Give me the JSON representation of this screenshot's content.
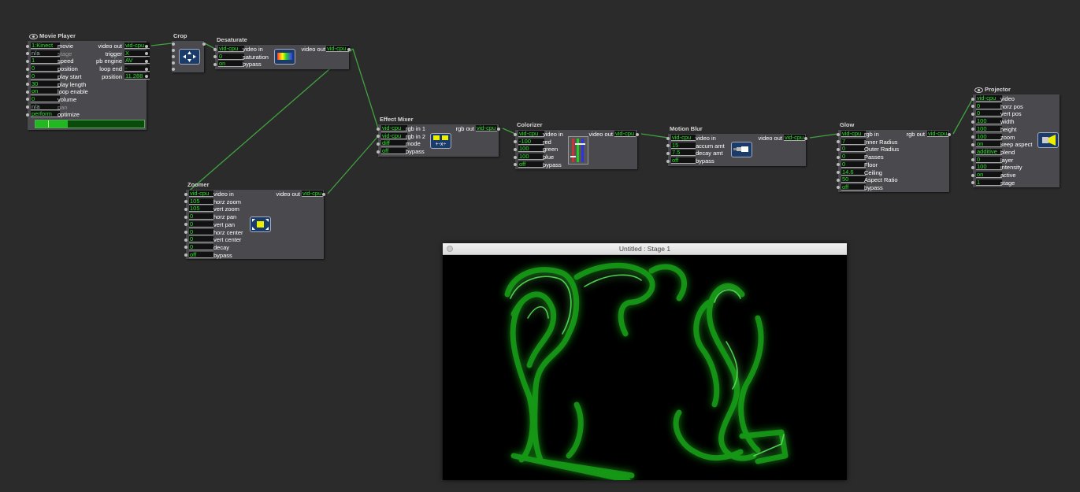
{
  "stage_window": {
    "title": "Untitled : Stage 1"
  },
  "actors": {
    "movie_player": {
      "title": "Movie Player",
      "inputs": [
        {
          "value": "1:Kinect",
          "label": "movie"
        },
        {
          "value": "n/a",
          "label": "stage",
          "dim": true
        },
        {
          "value": "1",
          "label": "speed"
        },
        {
          "value": "0",
          "label": "position"
        },
        {
          "value": "0",
          "label": "play start"
        },
        {
          "value": "30",
          "label": "play length"
        },
        {
          "value": "on",
          "label": "loop enable"
        },
        {
          "value": "0",
          "label": "volume"
        },
        {
          "value": "n/a",
          "label": "pan",
          "dim": true
        },
        {
          "value": "perform",
          "label": "optimize"
        }
      ],
      "outputs": [
        {
          "label": "video out",
          "value": "vid-cpu"
        },
        {
          "label": "trigger",
          "value": "X"
        },
        {
          "label": "pb engine",
          "value": "AV"
        },
        {
          "label": "loop end",
          "value": "-"
        },
        {
          "label": "position",
          "value": "11.288"
        }
      ],
      "progress": 0.3
    },
    "crop": {
      "title": "Crop"
    },
    "desaturate": {
      "title": "Desaturate",
      "inputs": [
        {
          "value": "vid-cpu",
          "label": "video in"
        },
        {
          "value": "0",
          "label": "saturation"
        },
        {
          "value": "on",
          "label": "bypass"
        }
      ],
      "outputs": [
        {
          "label": "video out",
          "value": "vid-cpu"
        }
      ]
    },
    "effect_mixer": {
      "title": "Effect Mixer",
      "inputs": [
        {
          "value": "vid-cpu",
          "label": "rgb in 1"
        },
        {
          "value": "vid-cpu",
          "label": "rgb in 2"
        },
        {
          "value": "diff",
          "label": "mode"
        },
        {
          "value": "off",
          "label": "bypass"
        }
      ],
      "outputs": [
        {
          "label": "rgb out",
          "value": "vid-cpu"
        }
      ]
    },
    "colorizer": {
      "title": "Colorizer",
      "inputs": [
        {
          "value": "vid-cpu",
          "label": "video in"
        },
        {
          "value": "-100",
          "label": "red"
        },
        {
          "value": "100",
          "label": "green"
        },
        {
          "value": "100",
          "label": "blue"
        },
        {
          "value": "off",
          "label": "bypass"
        }
      ],
      "outputs": [
        {
          "label": "video out",
          "value": "vid-cpu"
        }
      ]
    },
    "motion_blur": {
      "title": "Motion Blur",
      "inputs": [
        {
          "value": "vid-cpu",
          "label": "video in"
        },
        {
          "value": "15",
          "label": "accum amt"
        },
        {
          "value": "7.5",
          "label": "decay amt"
        },
        {
          "value": "off",
          "label": "bypass"
        }
      ],
      "outputs": [
        {
          "label": "video out",
          "value": "vid-cpu"
        }
      ]
    },
    "glow": {
      "title": "Glow",
      "inputs": [
        {
          "value": "vid-cpu",
          "label": "rgb in"
        },
        {
          "value": "7",
          "label": "Inner Radius"
        },
        {
          "value": "0",
          "label": "Outer Radius"
        },
        {
          "value": "0",
          "label": "Passes"
        },
        {
          "value": "0",
          "label": "Floor"
        },
        {
          "value": "14.6",
          "label": "Ceiling"
        },
        {
          "value": "50",
          "label": "Aspect Ratio"
        },
        {
          "value": "off",
          "label": "bypass"
        }
      ],
      "outputs": [
        {
          "label": "rgb out",
          "value": "vid-cpu"
        }
      ]
    },
    "projector": {
      "title": "Projector",
      "inputs": [
        {
          "value": "vid-cpu",
          "label": "video"
        },
        {
          "value": "0",
          "label": "horz pos"
        },
        {
          "value": "0",
          "label": "vert pos"
        },
        {
          "value": "100",
          "label": "width"
        },
        {
          "value": "100",
          "label": "height"
        },
        {
          "value": "100",
          "label": "zoom"
        },
        {
          "value": "on",
          "label": "keep aspect"
        },
        {
          "value": "additive",
          "label": "blend"
        },
        {
          "value": "0",
          "label": "layer"
        },
        {
          "value": "100",
          "label": "intensity"
        },
        {
          "value": "on",
          "label": "active"
        },
        {
          "value": "1",
          "label": "stage"
        }
      ]
    },
    "zoomer": {
      "title": "Zoomer",
      "inputs": [
        {
          "value": "vid-cpu",
          "label": "video in"
        },
        {
          "value": "105",
          "label": "horz zoom"
        },
        {
          "value": "105",
          "label": "vert zoom"
        },
        {
          "value": "0",
          "label": "horz pan"
        },
        {
          "value": "0",
          "label": "vert pan"
        },
        {
          "value": "0",
          "label": "horz center"
        },
        {
          "value": "0",
          "label": "vert center"
        },
        {
          "value": "0",
          "label": "decay"
        },
        {
          "value": "off",
          "label": "bypass"
        }
      ],
      "outputs": [
        {
          "label": "video out",
          "value": "vid-cpu"
        }
      ]
    }
  }
}
